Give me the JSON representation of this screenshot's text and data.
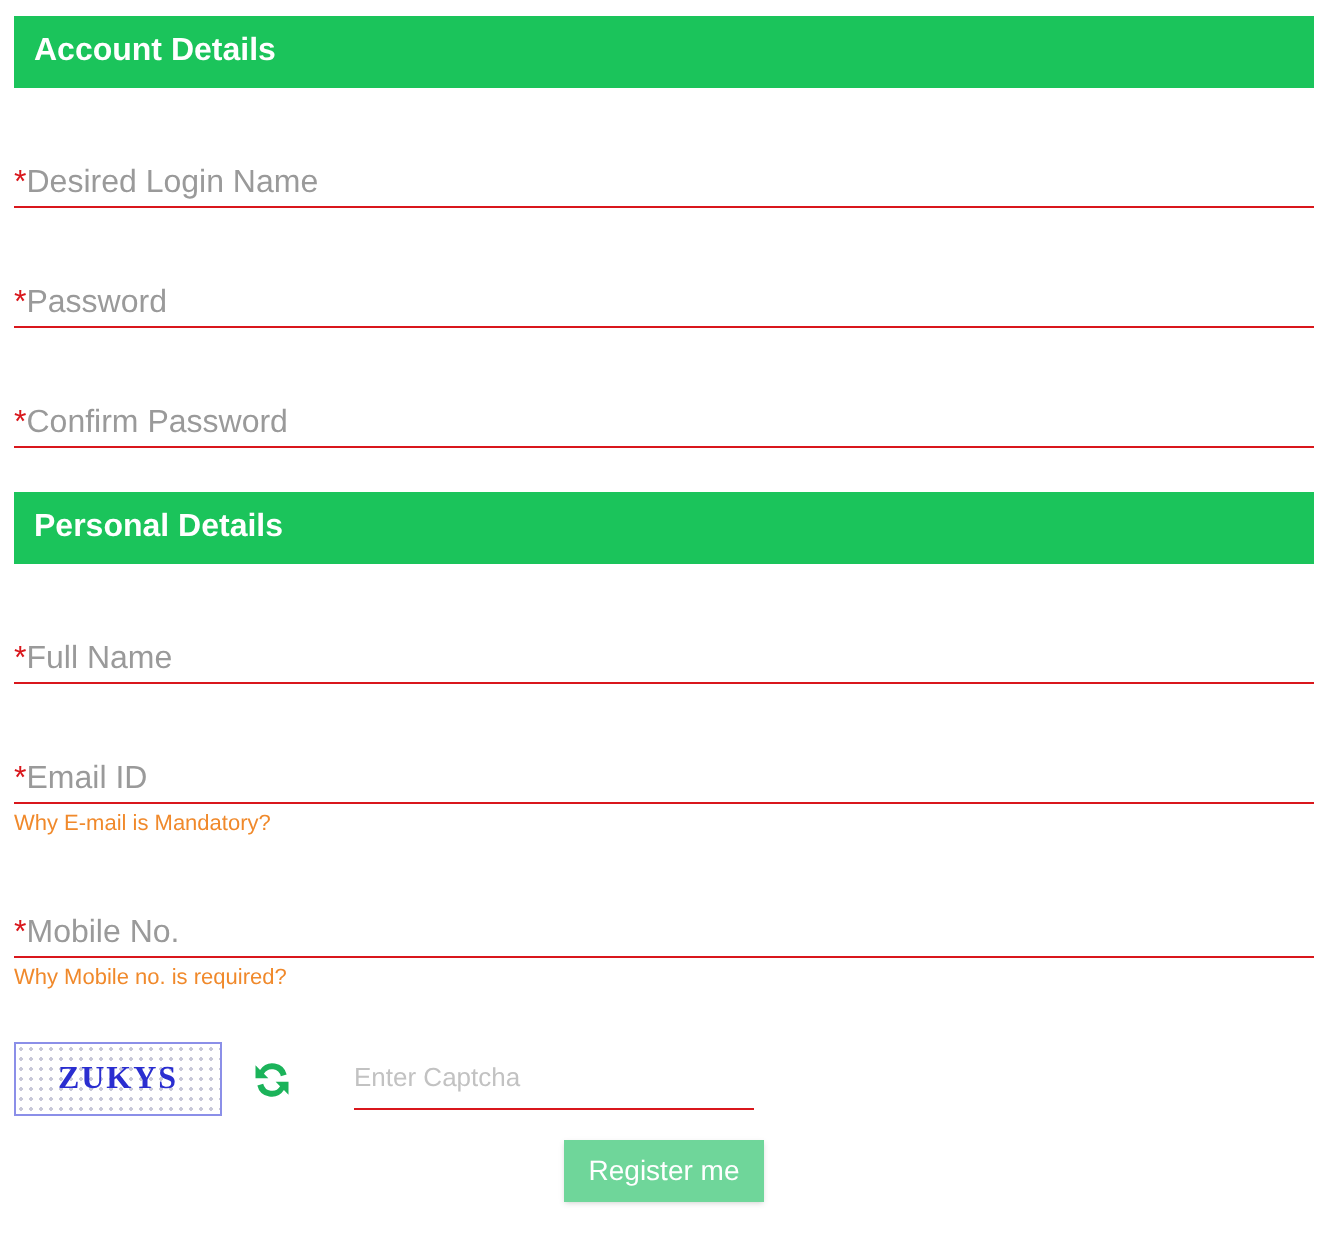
{
  "sections": [
    {
      "title": "Account Details",
      "fields": [
        {
          "marker": "*",
          "placeholder": "Desired Login Name"
        },
        {
          "marker": "*",
          "placeholder": "Password"
        },
        {
          "marker": "*",
          "placeholder": "Confirm Password"
        }
      ]
    },
    {
      "title": "Personal Details",
      "fields": [
        {
          "marker": "*",
          "placeholder": "Full Name"
        },
        {
          "marker": "*",
          "placeholder": "Email ID",
          "help": "Why E-mail is Mandatory?"
        },
        {
          "marker": "*",
          "placeholder": "Mobile No.",
          "help": "Why Mobile no. is required?"
        }
      ]
    }
  ],
  "captcha": {
    "image_text": "ZUKYS",
    "placeholder": "Enter Captcha"
  },
  "submit": {
    "label": "Register me"
  }
}
